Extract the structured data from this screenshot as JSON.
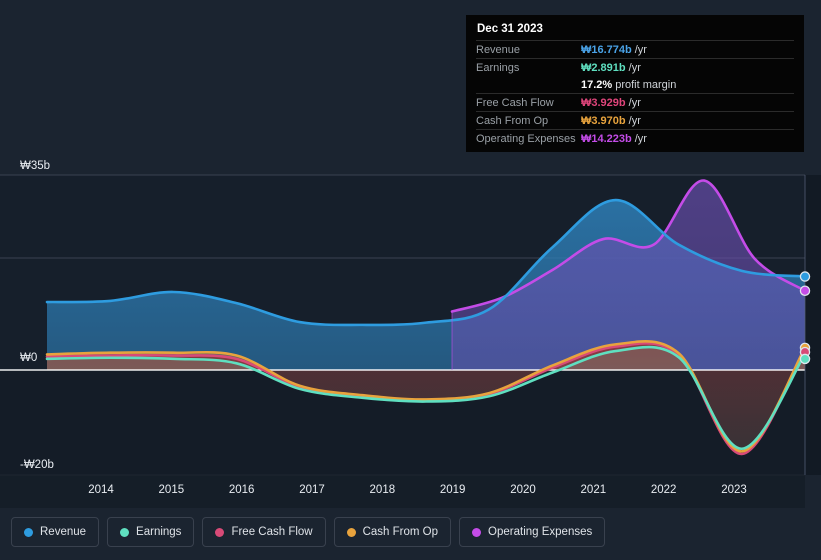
{
  "chart_data": {
    "type": "area",
    "title": "",
    "xlabel": "",
    "ylabel": "",
    "currency": "₩",
    "unit": "b",
    "grid": true,
    "legend_position": "bottom",
    "x": [
      2013.5,
      2014,
      2015,
      2016,
      2017,
      2018,
      2019,
      2020,
      2021,
      2022,
      2023,
      2023.9
    ],
    "xticks": [
      "2014",
      "2015",
      "2016",
      "2017",
      "2018",
      "2019",
      "2020",
      "2021",
      "2022",
      "2023"
    ],
    "yticks": [
      "₩35b",
      "₩0",
      "-₩20b"
    ],
    "ylim": [
      -20,
      35
    ],
    "axis_top_label": "₩35b",
    "axis_zero_label": "₩0",
    "axis_bottom_label": "-₩20b",
    "series": [
      {
        "name": "Revenue",
        "color": "#2e9ce0",
        "fill": "#1d4c6e",
        "values": [
          12.2,
          12.4,
          14.0,
          12.0,
          8.6,
          8.1,
          8.5,
          10.9,
          22.0,
          30.5,
          22.5,
          17.8,
          16.774
        ]
      },
      {
        "name": "Earnings",
        "color": "#5fdfc0",
        "fill": "#6d8f7e",
        "values": [
          2.0,
          2.2,
          2.0,
          1.2,
          -3.6,
          -5.3,
          -6.0,
          -5.0,
          -0.5,
          3.4,
          2.3,
          -15.0,
          2.891
        ]
      },
      {
        "name": "Free Cash Flow",
        "color": "#d84a77",
        "fill": "#7d2b3c",
        "values": [
          2.4,
          2.6,
          2.6,
          2.0,
          -3.2,
          -5.0,
          -5.8,
          -4.6,
          0.4,
          4.2,
          2.7,
          -16.0,
          3.929
        ]
      },
      {
        "name": "Cash From Op",
        "color": "#e8a33d",
        "fill": "#8a7543",
        "values": [
          2.8,
          3.1,
          3.1,
          2.6,
          -3.0,
          -4.8,
          -5.6,
          -4.4,
          0.8,
          4.6,
          3.0,
          -15.5,
          3.97
        ]
      },
      {
        "name": "Operating Expenses",
        "color": "#c44ce8",
        "fill": "#4a3a7a",
        "start_year": 2019,
        "values": [
          10.5,
          13.0,
          18.0,
          23.5,
          22.5,
          34.0,
          20.0,
          14.223
        ]
      }
    ]
  },
  "tooltip": {
    "title": "Dec 31 2023",
    "suffix": "/yr",
    "rows": [
      {
        "key": "Revenue",
        "value": "₩16.774b",
        "suffix": "/yr",
        "color": "#4aa3e8"
      },
      {
        "key": "Earnings",
        "value": "₩2.891b",
        "suffix": "/yr",
        "color": "#5fdfc0"
      },
      {
        "key": "",
        "value": "17.2%",
        "suffix": "profit margin",
        "color": "#ffffff"
      },
      {
        "key": "Free Cash Flow",
        "value": "₩3.929b",
        "suffix": "/yr",
        "color": "#e0457b"
      },
      {
        "key": "Cash From Op",
        "value": "₩3.970b",
        "suffix": "/yr",
        "color": "#e8a33d"
      },
      {
        "key": "Operating Expenses",
        "value": "₩14.223b",
        "suffix": "/yr",
        "color": "#c44ce8"
      }
    ]
  },
  "legend": {
    "items": [
      {
        "label": "Revenue",
        "color": "#2e9ce0"
      },
      {
        "label": "Earnings",
        "color": "#5fdfc0"
      },
      {
        "label": "Free Cash Flow",
        "color": "#d84a77"
      },
      {
        "label": "Cash From Op",
        "color": "#e8a33d"
      },
      {
        "label": "Operating Expenses",
        "color": "#c44ce8"
      }
    ]
  }
}
